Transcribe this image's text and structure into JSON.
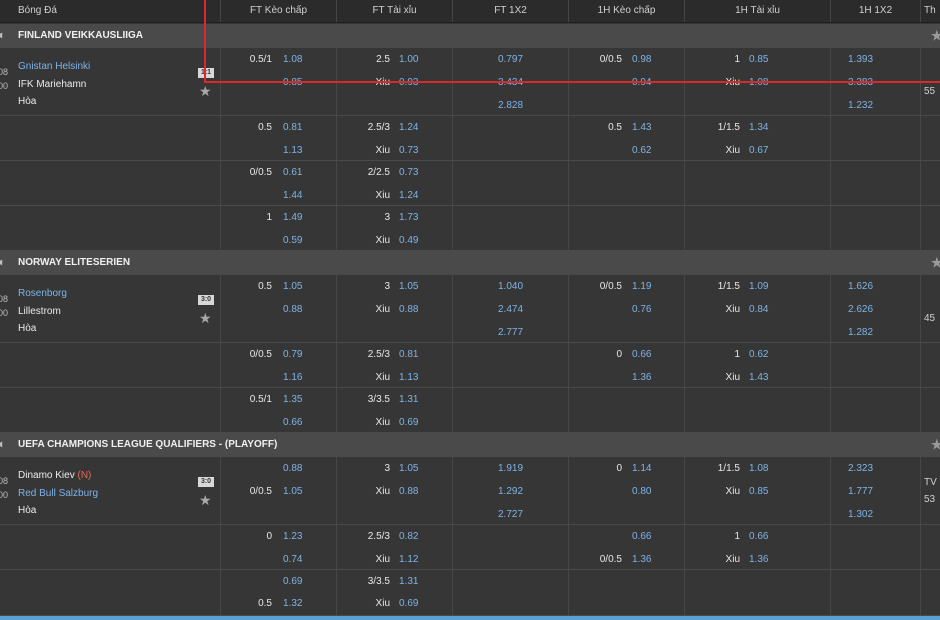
{
  "header": {
    "sport": "Bóng Đá",
    "cols": [
      "FT Kèo chấp",
      "FT Tài xỉu",
      "FT 1X2",
      "1H Kèo chấp",
      "1H Tài xỉu",
      "1H 1X2"
    ],
    "last": "Th"
  },
  "leagues": [
    {
      "name": "FINLAND VEIKKAUSLIIGA",
      "home": "Gnistan Helsinki",
      "away": "IFK Mariehamn",
      "draw": "Hòa",
      "neutral": "",
      "date_a": "08",
      "date_b": "00",
      "icon": "1:1",
      "right_a": "",
      "right_b": "55",
      "rows": [
        {
          "fth": "0.5/1",
          "fthv1": "1.08",
          "fthv2": "0.85",
          "fto": "2.5",
          "ftov1": "1.00",
          "ftox": "Xiu",
          "ftov2": "0.93",
          "x1": "0.797",
          "x2": "3.434",
          "x3": "2.828",
          "h1h": "0/0.5",
          "h1hv1": "0.98",
          "h1hv2": "0.94",
          "h1o": "1",
          "h1ov1": "0.85",
          "h1ox": "Xiu",
          "h1ov2": "1.08",
          "hx1": "1.393",
          "hx2": "3.383",
          "hx3": "1.232"
        },
        {
          "fth": "0.5",
          "fthv1": "0.81",
          "fthv2": "1.13",
          "fto": "2.5/3",
          "ftov1": "1.24",
          "ftox": "Xiu",
          "ftov2": "0.73",
          "h1h": "0.5",
          "h1hv1": "1.43",
          "h1hv2": "0.62",
          "h1o": "1/1.5",
          "h1ov1": "1.34",
          "h1ox": "Xiu",
          "h1ov2": "0.67"
        },
        {
          "fth": "0/0.5",
          "fthv1": "0.61",
          "fthv2": "1.44",
          "fto": "2/2.5",
          "ftov1": "0.73",
          "ftox": "Xiu",
          "ftov2": "1.24"
        },
        {
          "fth": "1",
          "fthv1": "1.49",
          "fthv2": "0.59",
          "fto": "3",
          "ftov1": "1.73",
          "ftox": "Xiu",
          "ftov2": "0.49"
        }
      ]
    },
    {
      "name": "NORWAY ELITESERIEN",
      "home": "Rosenborg",
      "away": "Lillestrom",
      "draw": "Hòa",
      "neutral": "",
      "date_a": "08",
      "date_b": "00",
      "icon": "3:0",
      "right_a": "",
      "right_b": "45",
      "rows": [
        {
          "fth": "0.5",
          "fthv1": "1.05",
          "fthv2": "0.88",
          "fto": "3",
          "ftov1": "1.05",
          "ftox": "Xiu",
          "ftov2": "0.88",
          "x1": "1.040",
          "x2": "2.474",
          "x3": "2.777",
          "h1h": "0/0.5",
          "h1hv1": "1.19",
          "h1hv2": "0.76",
          "h1o": "1/1.5",
          "h1ov1": "1.09",
          "h1ox": "Xiu",
          "h1ov2": "0.84",
          "hx1": "1.626",
          "hx2": "2.626",
          "hx3": "1.282"
        },
        {
          "fth": "0/0.5",
          "fthv1": "0.79",
          "fthv2": "1.16",
          "fto": "2.5/3",
          "ftov1": "0.81",
          "ftox": "Xiu",
          "ftov2": "1.13",
          "h1h": "0",
          "h1hv1": "0.66",
          "h1hv2": "1.36",
          "h1o": "1",
          "h1ov1": "0.62",
          "h1ox": "Xiu",
          "h1ov2": "1.43"
        },
        {
          "fth": "0.5/1",
          "fthv1": "1.35",
          "fthv2": "0.66",
          "fto": "3/3.5",
          "ftov1": "1.31",
          "ftox": "Xiu",
          "ftov2": "0.69"
        }
      ]
    },
    {
      "name": "UEFA CHAMPIONS LEAGUE QUALIFIERS - (PLAYOFF)",
      "home": "Dinamo Kiev",
      "away": "Red Bull Salzburg",
      "draw": "Hòa",
      "neutral": "(N)",
      "date_a": "08",
      "date_b": "00",
      "icon": "3:0",
      "right_a": "TV",
      "right_b": "53",
      "rows": [
        {
          "fth": "",
          "fthv1": "0.88",
          "fth2": "0/0.5",
          "fthv2": "1.05",
          "fto": "3",
          "ftov1": "1.05",
          "ftox": "Xiu",
          "ftov2": "0.88",
          "x1": "1.919",
          "x2": "1.292",
          "x3": "2.727",
          "h1h": "0",
          "h1hv1": "1.14",
          "h1hv2": "0.80",
          "h1o": "1/1.5",
          "h1ov1": "1.08",
          "h1ox": "Xiu",
          "h1ov2": "0.85",
          "hx1": "2.323",
          "hx2": "1.777",
          "hx3": "1.302"
        },
        {
          "fth": "0",
          "fthv1": "1.23",
          "fthv2": "0.74",
          "fto": "2.5/3",
          "ftov1": "0.82",
          "ftox": "Xiu",
          "ftov2": "1.12",
          "h1h": "",
          "h1hv1": "0.66",
          "h1h2": "0/0.5",
          "h1hv2": "1.36",
          "h1o": "1",
          "h1ov1": "0.66",
          "h1ox": "Xiu",
          "h1ov2": "1.36"
        },
        {
          "fth": "",
          "fthv1": "0.69",
          "fth2": "0.5",
          "fthv2": "1.32",
          "fto": "3/3.5",
          "ftov1": "1.31",
          "ftox": "Xiu",
          "ftov2": "0.69"
        }
      ]
    }
  ]
}
